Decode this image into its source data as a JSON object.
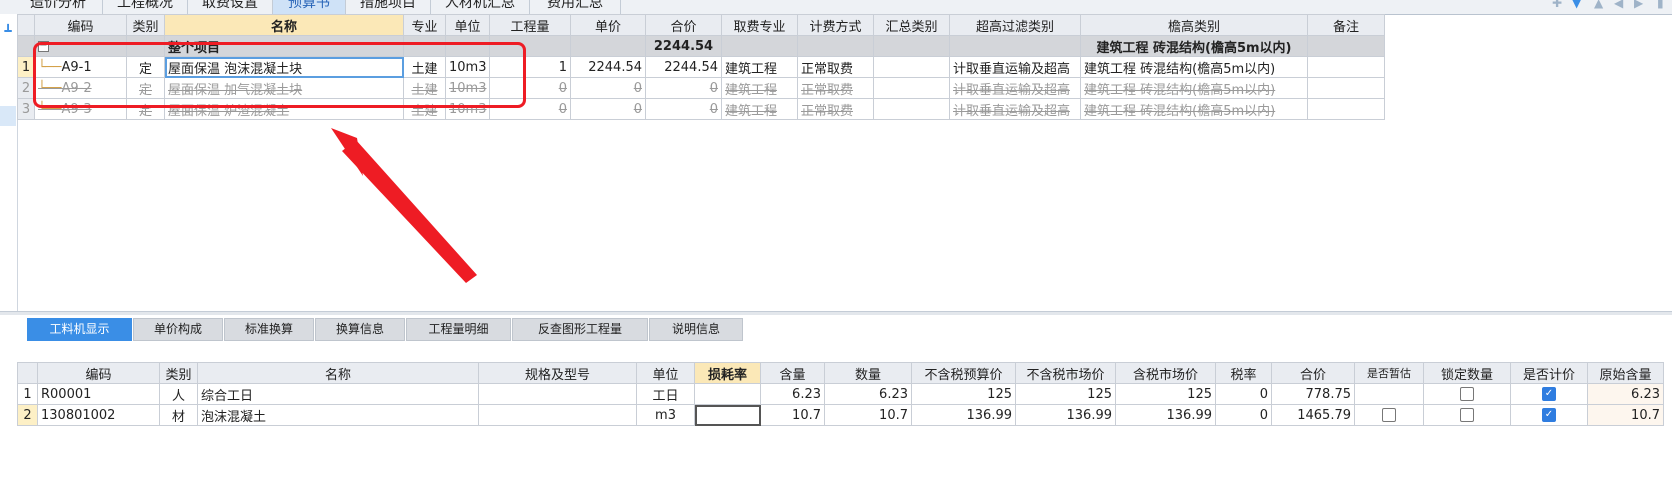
{
  "top_tabs": [
    "造价分析",
    "工程概况",
    "取费设置",
    "预算书",
    "措施项目",
    "人材机汇总",
    "费用汇总"
  ],
  "top_tabs_active": "预算书",
  "upper_table": {
    "headers": [
      "编码",
      "类别",
      "名称",
      "专业",
      "单位",
      "工程量",
      "单价",
      "合价",
      "取费专业",
      "计费方式",
      "汇总类别",
      "超高过滤类别",
      "檐高类别",
      "备注"
    ],
    "group_row": {
      "name": "整个项目",
      "total": "2244.54",
      "eave": "建筑工程 砖混结构(檐高5m以内)"
    },
    "rows": [
      {
        "rn": "1",
        "code": "A9-1",
        "type": "定",
        "name": "屋面保温 泡沫混凝土块",
        "major": "土建",
        "unit": "10m3",
        "qty": "1",
        "price": "2244.54",
        "total": "2244.54",
        "fee_major": "建筑工程",
        "calc": "正常取费",
        "summary": "",
        "super_high": "计取垂直运输及超高",
        "eave": "建筑工程 砖混结构(檐高5m以内)",
        "note": ""
      },
      {
        "rn": "2",
        "code": "A9-2",
        "type": "定",
        "name": "屋面保温 加气混凝土块",
        "major": "土建",
        "unit": "10m3",
        "qty": "0",
        "price": "0",
        "total": "0",
        "fee_major": "建筑工程",
        "calc": "正常取费",
        "summary": "",
        "super_high": "计取垂直运输及超高",
        "eave": "建筑工程 砖混结构(檐高5m以内)",
        "note": ""
      },
      {
        "rn": "3",
        "code": "A9-3",
        "type": "定",
        "name": "屋面保温 炉渣混凝土",
        "major": "土建",
        "unit": "10m3",
        "qty": "0",
        "price": "0",
        "total": "0",
        "fee_major": "建筑工程",
        "calc": "正常取费",
        "summary": "",
        "super_high": "计取垂直运输及超高",
        "eave": "建筑工程 砖混结构(檐高5m以内)",
        "note": ""
      }
    ]
  },
  "bottom_tabs": [
    "工料机显示",
    "单价构成",
    "标准换算",
    "换算信息",
    "工程量明细",
    "反查图形工程量",
    "说明信息"
  ],
  "bottom_tabs_active": "工料机显示",
  "lower_table": {
    "headers": [
      "编码",
      "类别",
      "名称",
      "规格及型号",
      "单位",
      "损耗率",
      "含量",
      "数量",
      "不含税预算价",
      "不含税市场价",
      "含税市场价",
      "税率",
      "合价",
      "是否暂估",
      "锁定数量",
      "是否计价",
      "原始含量"
    ],
    "rows": [
      {
        "rn": "1",
        "code": "R00001",
        "type": "人",
        "name": "综合工日",
        "spec": "",
        "unit": "工日",
        "loss": "",
        "content": "6.23",
        "qty": "6.23",
        "budget": "125",
        "market": "125",
        "market_tax": "125",
        "tax": "0",
        "total": "778.75",
        "provisional": null,
        "locked": false,
        "priced": true,
        "orig": "6.23"
      },
      {
        "rn": "2",
        "code": "130801002",
        "type": "材",
        "name": "泡沫混凝土",
        "spec": "",
        "unit": "m3",
        "loss": "",
        "content": "10.7",
        "qty": "10.7",
        "budget": "136.99",
        "market": "136.99",
        "market_tax": "136.99",
        "tax": "0",
        "total": "1465.79",
        "provisional": false,
        "locked": false,
        "priced": true,
        "orig": "10.7"
      }
    ]
  },
  "colors": {
    "accent": "#3a8ee6",
    "annotation": "#ee1c24",
    "group_bg": "#d4d6da"
  },
  "icons": [
    "pin-icon",
    "filter-icon",
    "arrow-up-icon",
    "arrow-down-icon",
    "arrow-left-icon",
    "arrow-right-icon"
  ]
}
